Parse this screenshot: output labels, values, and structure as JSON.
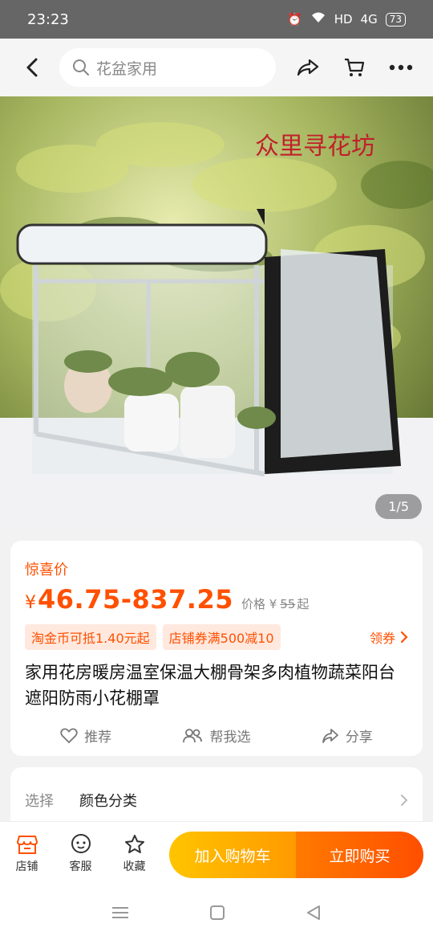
{
  "status_bar": {
    "time": "23:23",
    "network": "HD",
    "signal": "4G",
    "battery": "73"
  },
  "search": {
    "placeholder": "花盆家用"
  },
  "hero": {
    "counter": "1/5",
    "brand_text": "众里寻花坊"
  },
  "price": {
    "tag": "惊喜价",
    "symbol": "¥",
    "range": "46.75-837.25",
    "orig_label": "价格 ¥",
    "orig_price": "55",
    "orig_suffix": "起"
  },
  "promos": [
    {
      "label": "淘金币可抵1.40元起"
    },
    {
      "label": "店铺券满500减10"
    }
  ],
  "coupon_link": "领券",
  "product_title": "家用花房暖房温室保温大棚骨架多肉植物蔬菜阳台遮阳防雨小花棚罩",
  "actions": {
    "recommend": "推荐",
    "help_choose": "帮我选",
    "share": "分享"
  },
  "select": {
    "label": "选择",
    "value": "颜色分类"
  },
  "bottom_tabs": {
    "store": "店铺",
    "service": "客服",
    "favorite": "收藏"
  },
  "cta": {
    "add_to_cart": "加入购物车",
    "buy_now": "立即购买"
  },
  "colors": {
    "accent": "#ff5000",
    "cart_btn": "#ffb000",
    "buy_btn": "#ff5a00"
  }
}
